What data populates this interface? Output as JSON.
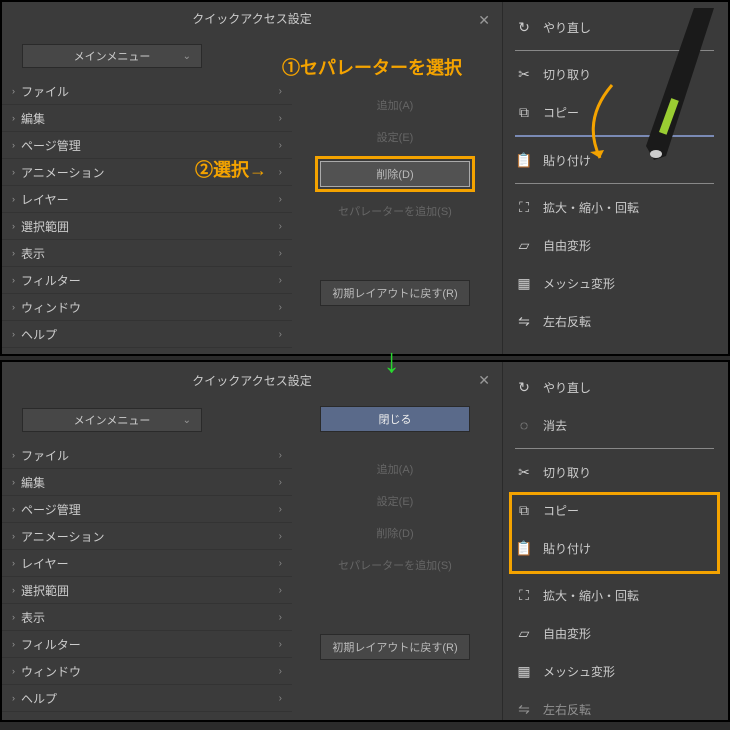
{
  "annotations": {
    "step1": "①セパレーターを選択",
    "step2": "②選択→"
  },
  "dialog": {
    "title": "クイックアクセス設定",
    "dropdown": "メインメニュー",
    "tree": [
      "ファイル",
      "編集",
      "ページ管理",
      "アニメーション",
      "レイヤー",
      "選択範囲",
      "表示",
      "フィルター",
      "ウィンドウ",
      "ヘルプ"
    ],
    "buttons": {
      "close": "閉じる",
      "add": "追加(A)",
      "settings": "設定(E)",
      "delete": "削除(D)",
      "add_separator": "セパレーターを追加(S)",
      "reset": "初期レイアウトに戻す(R)"
    }
  },
  "quick": {
    "redo": "やり直し",
    "erase": "消去",
    "cut": "切り取り",
    "copy": "コピー",
    "paste": "貼り付け",
    "transform": "拡大・縮小・回転",
    "free_transform": "自由変形",
    "mesh": "メッシュ変形",
    "flip_h": "左右反転"
  }
}
